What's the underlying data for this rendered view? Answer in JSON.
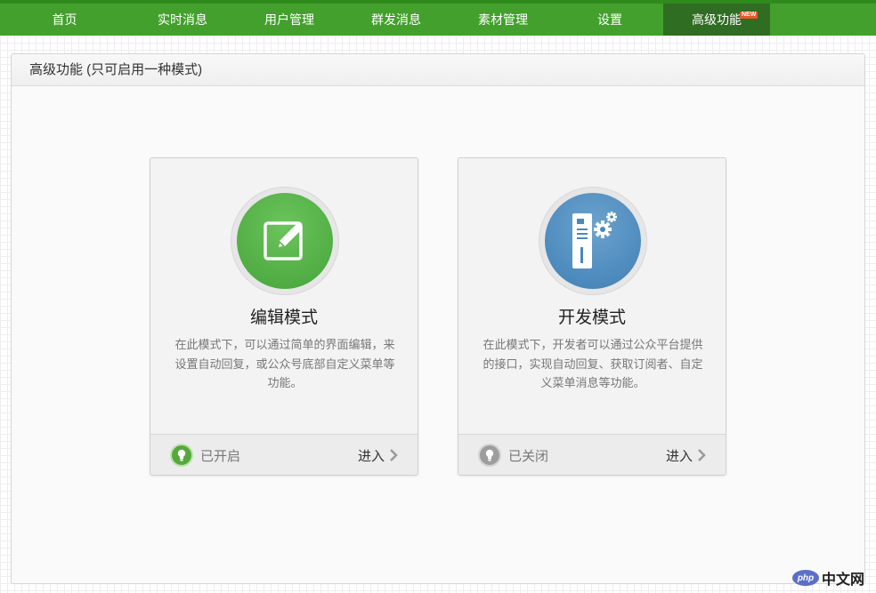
{
  "nav": {
    "items": [
      {
        "label": "首页"
      },
      {
        "label": "实时消息"
      },
      {
        "label": "用户管理"
      },
      {
        "label": "群发消息"
      },
      {
        "label": "素材管理"
      },
      {
        "label": "设置"
      },
      {
        "label": "高级功能",
        "badge": "NEW"
      }
    ],
    "active_index": 6
  },
  "panel": {
    "title": "高级功能 (只可启用一种模式)"
  },
  "cards": [
    {
      "title": "编辑模式",
      "description": "在此模式下，可以通过简单的界面编辑，来设置自动回复，或公众号底部自定义菜单等功能。",
      "status": "已开启",
      "enter_label": "进入",
      "icon": "edit-icon",
      "color": "#4fa843"
    },
    {
      "title": "开发模式",
      "description": "在此模式下，开发者可以通过公众平台提供的接口，实现自动回复、获取订阅者、自定义菜单消息等功能。",
      "status": "已关闭",
      "enter_label": "进入",
      "icon": "server-gear-icon",
      "color": "#4a88bd"
    }
  ],
  "watermark": {
    "logo": "php",
    "text": "中文网"
  },
  "colors": {
    "nav_bg": "#43a02c",
    "nav_active": "#2f6d22",
    "badge": "#e8572a"
  }
}
